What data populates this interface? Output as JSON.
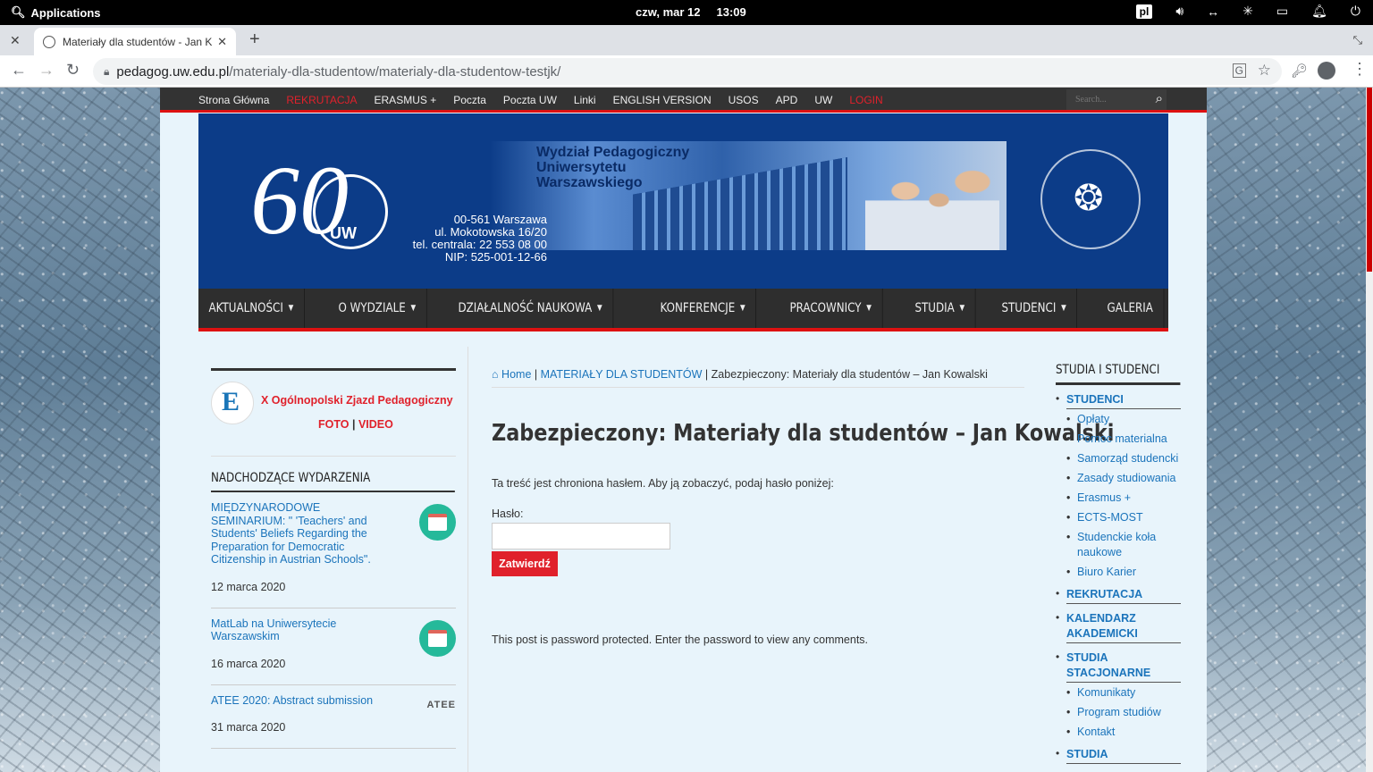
{
  "system_bar": {
    "apps_label": "Applications",
    "date": "czw, mar 12",
    "time": "13:09",
    "lang": "pl"
  },
  "browser": {
    "tab_title": "Materiały dla studentów - Jan K",
    "url_host": "pedagog.uw.edu.pl",
    "url_path": "/materialy-dla-studentow/materialy-dla-studentow-testjk/"
  },
  "site": {
    "top_nav": [
      {
        "label": "Strona Główna",
        "accent": false
      },
      {
        "label": "REKRUTACJA",
        "accent": true
      },
      {
        "label": "ERASMUS +",
        "accent": false
      },
      {
        "label": "Poczta",
        "accent": false
      },
      {
        "label": "Poczta UW",
        "accent": false
      },
      {
        "label": "Linki",
        "accent": false
      },
      {
        "label": "ENGLISH VERSION",
        "accent": false
      },
      {
        "label": "USOS",
        "accent": false
      },
      {
        "label": "APD",
        "accent": false
      },
      {
        "label": "UW",
        "accent": false
      },
      {
        "label": "LOGIN",
        "accent": true
      }
    ],
    "search_placeholder": "Search...",
    "banner": {
      "title_line1": "Wydział Pedagogiczny",
      "title_line2": "Uniwersytetu",
      "title_line3": "Warszawskiego",
      "addr1": "00-561 Warszawa",
      "addr2": "ul. Mokotowska 16/20",
      "addr3": "tel. centrala: 22 553 08 00",
      "addr4": "NIP: 525-001-12-66",
      "logo_number": "60",
      "logo_text": "UW"
    },
    "main_nav": [
      {
        "label": "AKTUALNOŚCI",
        "dropdown": true
      },
      {
        "label": "O WYDZIALE",
        "dropdown": true
      },
      {
        "label": "DZIAŁALNOŚĆ NAUKOWA",
        "dropdown": true
      },
      {
        "label": "KONFERENCJE",
        "dropdown": true
      },
      {
        "label": "PRACOWNICY",
        "dropdown": true
      },
      {
        "label": "STUDIA",
        "dropdown": true
      },
      {
        "label": "STUDENCI",
        "dropdown": true
      },
      {
        "label": "GALERIA",
        "dropdown": false
      }
    ],
    "accent_red": "#e0212b",
    "link_blue": "#1b74bb"
  },
  "left_sidebar": {
    "zjazd_title": "X Ogólnopolski Zjazd Pedagogiczny",
    "foto": "FOTO",
    "video": "VIDEO",
    "sep": "|",
    "events_title": "NADCHODZĄCE WYDARZENIA",
    "events": [
      {
        "title": "MIĘDZYNARODOWE SEMINARIUM: \" 'Teachers' and Students' Beliefs Regarding the Preparation for Democratic Citizenship in Austrian Schools\".",
        "date": "12 marca 2020",
        "icon": "calendar-icon"
      },
      {
        "title": "MatLab na Uniwersytecie Warszawskim",
        "date": "16 marca 2020",
        "icon": "calendar-icon"
      },
      {
        "title": "ATEE 2020: Abstract submission",
        "date": "31 marca 2020",
        "icon": "atee-logo"
      }
    ],
    "atee_logo_text": "ATEE"
  },
  "content": {
    "breadcrumb": {
      "home": "Home",
      "sep": "|",
      "section": "MATERIAŁY DLA STUDENTÓW",
      "current": "Zabezpieczony: Materiały dla studentów – Jan Kowalski"
    },
    "title": "Zabezpieczony: Materiały dla studentów – Jan Kowalski",
    "protected_msg": "Ta treść jest chroniona hasłem. Aby ją zobaczyć, podaj hasło poniżej:",
    "password_label": "Hasło:",
    "password_value": "",
    "submit_label": "Zatwierdź",
    "comments_msg": "This post is password protected. Enter the password to view any comments."
  },
  "right_sidebar": {
    "title": "STUDIA I STUDENCI",
    "groups": [
      {
        "label": "STUDENCI",
        "items": [
          "Opłaty",
          "Pomoc materialna",
          "Samorząd studencki",
          "Zasady studiowania",
          "Erasmus +",
          "ECTS-MOST",
          "Studenckie koła naukowe",
          "Biuro Karier"
        ]
      },
      {
        "label": "REKRUTACJA",
        "items": []
      },
      {
        "label": "KALENDARZ AKADEMICKI",
        "items": []
      },
      {
        "label": "STUDIA STACJONARNE",
        "items": [
          "Komunikaty",
          "Program studiów",
          "Kontakt"
        ]
      },
      {
        "label": "STUDIA",
        "items": []
      }
    ]
  }
}
